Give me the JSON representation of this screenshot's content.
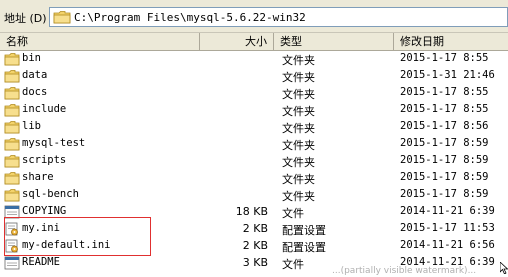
{
  "address_bar": {
    "label": "地址 (D)",
    "path": "C:\\Program Files\\mysql-5.6.22-win32"
  },
  "columns": {
    "name": "名称",
    "size": "大小",
    "type": "类型",
    "modified": "修改日期"
  },
  "files": [
    {
      "name": "bin",
      "size": "",
      "type": "文件夹",
      "modified": "2015-1-17 8:55",
      "icon": "folder-icon"
    },
    {
      "name": "data",
      "size": "",
      "type": "文件夹",
      "modified": "2015-1-31 21:46",
      "icon": "folder-icon"
    },
    {
      "name": "docs",
      "size": "",
      "type": "文件夹",
      "modified": "2015-1-17 8:55",
      "icon": "folder-icon"
    },
    {
      "name": "include",
      "size": "",
      "type": "文件夹",
      "modified": "2015-1-17 8:55",
      "icon": "folder-icon"
    },
    {
      "name": "lib",
      "size": "",
      "type": "文件夹",
      "modified": "2015-1-17 8:56",
      "icon": "folder-icon"
    },
    {
      "name": "mysql-test",
      "size": "",
      "type": "文件夹",
      "modified": "2015-1-17 8:59",
      "icon": "folder-icon"
    },
    {
      "name": "scripts",
      "size": "",
      "type": "文件夹",
      "modified": "2015-1-17 8:59",
      "icon": "folder-icon"
    },
    {
      "name": "share",
      "size": "",
      "type": "文件夹",
      "modified": "2015-1-17 8:59",
      "icon": "folder-icon"
    },
    {
      "name": "sql-bench",
      "size": "",
      "type": "文件夹",
      "modified": "2015-1-17 8:59",
      "icon": "folder-icon"
    },
    {
      "name": "COPYING",
      "size": "18 KB",
      "type": "文件",
      "modified": "2014-11-21 6:39",
      "icon": "file-icon"
    },
    {
      "name": "my.ini",
      "size": "2 KB",
      "type": "配置设置",
      "modified": "2015-1-17 11:53",
      "icon": "config-file-icon"
    },
    {
      "name": "my-default.ini",
      "size": "2 KB",
      "type": "配置设置",
      "modified": "2014-11-21 6:56",
      "icon": "config-file-icon"
    },
    {
      "name": "README",
      "size": "3 KB",
      "type": "文件",
      "modified": "2014-11-21 6:39",
      "icon": "file-icon"
    }
  ],
  "colors": {
    "chrome": "#ece9d8",
    "highlight_box": "#e03030",
    "folder_yellow": "#f3d36b"
  },
  "watermark": "...(partially visible watermark)..."
}
